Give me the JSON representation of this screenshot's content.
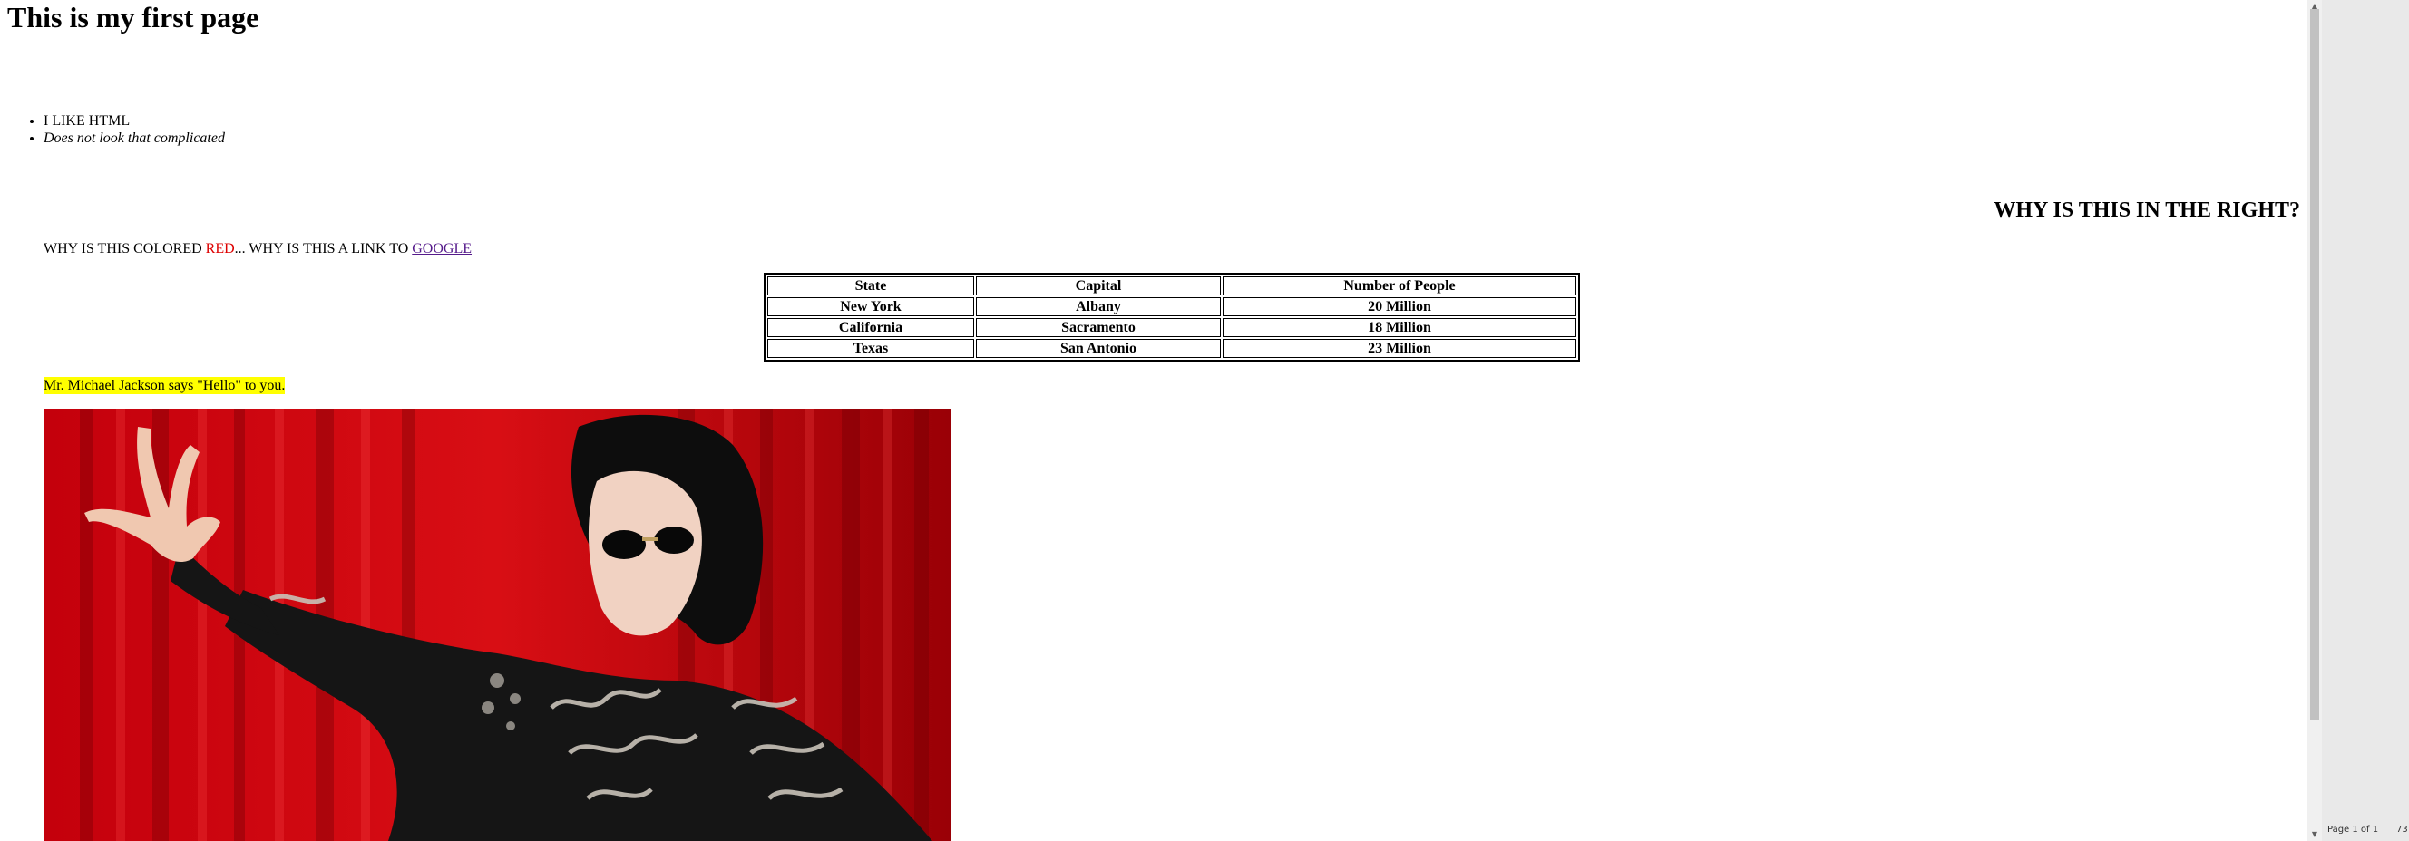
{
  "page": {
    "title": "This is my first page",
    "list_items": [
      {
        "text": "I LIKE HTML",
        "italic": false
      },
      {
        "text": "Does not look that complicated",
        "italic": true
      }
    ],
    "right_heading": "WHY IS THIS IN THE RIGHT?",
    "colored_line": {
      "before": "WHY IS THIS COLORED ",
      "red_word": "RED",
      "middle": "... WHY IS THIS A LINK TO ",
      "link_text": "GOOGLE"
    },
    "table": {
      "headers": [
        "State",
        "Capital",
        "Number of People"
      ],
      "rows": [
        [
          "New York",
          "Albany",
          "20 Million"
        ],
        [
          "California",
          "Sacramento",
          "18 Million"
        ],
        [
          "Texas",
          "San Antonio",
          "23 Million"
        ]
      ]
    },
    "highlight_text": "Mr. Michael Jackson says \"Hello\" to you.",
    "photo_alt": "photo of a performer in black jacket and sunglasses waving in front of a red curtain"
  },
  "status_bar": {
    "page_indicator": "Page 1 of 1",
    "zoom": "73"
  },
  "colors": {
    "red_text": "#dd0000",
    "link": "#551a8b",
    "highlight": "#ffff00",
    "curtain": "#b3000a"
  }
}
